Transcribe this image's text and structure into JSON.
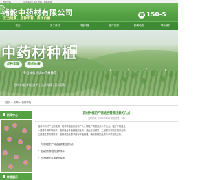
{
  "topbar": {
    "welcome": "欢迎光临",
    "links": "设为首页 | 加入收藏 | 网站地图"
  },
  "header": {
    "company": "浦毅中药材有限公司",
    "slogan": "实力雄厚，品种丰富，质优价廉",
    "phone": "150-5"
  },
  "nav": {
    "items": [
      "首页",
      "关于我们",
      "种苗种植",
      "客户服务",
      "新闻动态",
      "联系我们"
    ]
  },
  "banner": {
    "title": "中药材种植",
    "seal": "种植",
    "ovals": [
      "品种丰富",
      "质优价廉"
    ],
    "subtitle": "专业种植优质中药材种苗",
    "tags": "品种丰富 | 种植技术 | 品质保障 | 药材基地"
  },
  "breadcrumb": {
    "items": [
      "首页",
      "新闻",
      "药材种植"
    ]
  },
  "sidebar": {
    "section1": "新闻中心",
    "section2": "种苗展示"
  },
  "article": {
    "title": "药材种植的产销结合需要注意的几点",
    "meta": "发布时间：2020-06-09  浏览次数：162",
    "paragraphs": [
      "随着中药材产业的发展，药材种植面积逐年扩大，种植户需要注意以下几点，做好产销结合。",
      "一是要了解市场行情，选择适合本地种植的品种，避免盲目跟风。二是要与收购方签订合同。",
      "三是要注重药材质量，按照规范化要求进行种植管理，确保药材的品质与产量都能达标。"
    ],
    "bullets": [
      "药材种植的产销结合需要注意几点",
      "提高药材种植的技术水平",
      "药材种植的主要销售渠道"
    ]
  }
}
